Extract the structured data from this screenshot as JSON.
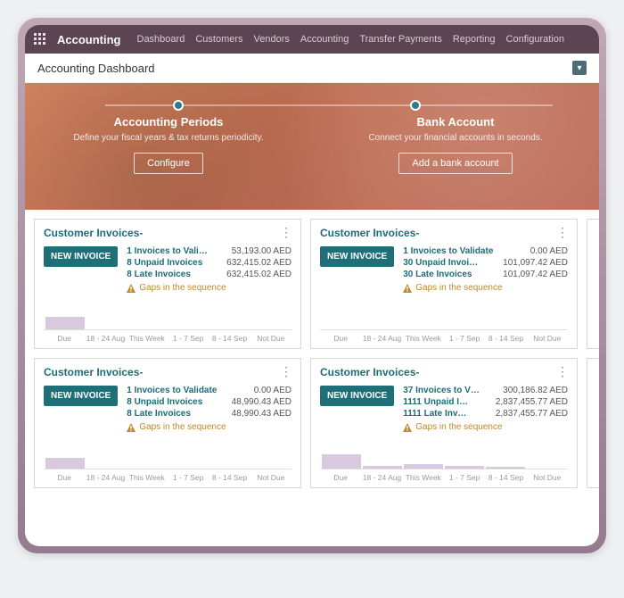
{
  "nav": {
    "brand": "Accounting",
    "items": [
      "Dashboard",
      "Customers",
      "Vendors",
      "Accounting",
      "Transfer Payments",
      "Reporting",
      "Configuration"
    ]
  },
  "page_title": "Accounting Dashboard",
  "hero": {
    "steps": [
      {
        "title": "Accounting Periods",
        "desc": "Define your fiscal years & tax returns periodicity.",
        "button": "Configure"
      },
      {
        "title": "Bank Account",
        "desc": "Connect your financial accounts in seconds.",
        "button": "Add a bank account"
      }
    ]
  },
  "axis_labels": [
    "Due",
    "18 - 24 Aug",
    "This Week",
    "1 - 7 Sep",
    "8 - 14 Sep",
    "Not Due"
  ],
  "cards": [
    {
      "title": "Customer Invoices-",
      "button": "NEW INVOICE",
      "stats": [
        {
          "label": "1 Invoices to Vali…",
          "value": "53,193.00 AED"
        },
        {
          "label": "8 Unpaid Invoices",
          "value": "632,415.02 AED"
        },
        {
          "label": "8 Late Invoices",
          "value": "632,415.02 AED"
        }
      ],
      "warning": "Gaps in the sequence",
      "bars": [
        14,
        0,
        0,
        0,
        0,
        0
      ]
    },
    {
      "title": "Customer Invoices-",
      "button": "NEW INVOICE",
      "stats": [
        {
          "label": "1 Invoices to Validate",
          "value": "0.00 AED"
        },
        {
          "label": "30 Unpaid Invoi…",
          "value": "101,097.42 AED"
        },
        {
          "label": "30 Late Invoices",
          "value": "101,097.42 AED"
        }
      ],
      "warning": "Gaps in the sequence",
      "bars": [
        0,
        0,
        0,
        0,
        0,
        0
      ]
    },
    {
      "title": "Customer Invoices-",
      "button": "NEW INVOICE",
      "stats": [
        {
          "label": "1 Invoices to Validate",
          "value": "0.00 AED"
        },
        {
          "label": "8 Unpaid Invoices",
          "value": "48,990.43 AED"
        },
        {
          "label": "8 Late Invoices",
          "value": "48,990.43 AED"
        }
      ],
      "warning": "Gaps in the sequence",
      "bars": [
        12,
        0,
        0,
        0,
        0,
        0
      ]
    },
    {
      "title": "Customer Invoices-",
      "button": "NEW INVOICE",
      "stats": [
        {
          "label": "37 Invoices to V…",
          "value": "300,186.82 AED"
        },
        {
          "label": "1111 Unpaid I…",
          "value": "2,837,455.77 AED"
        },
        {
          "label": "1111 Late Inv…",
          "value": "2,837,455.77 AED"
        }
      ],
      "warning": "Gaps in the sequence",
      "bars": [
        16,
        3,
        5,
        3,
        2,
        0
      ]
    }
  ],
  "chart_data": [
    {
      "type": "bar",
      "title": "Customer Invoices",
      "categories": [
        "Due",
        "18 - 24 Aug",
        "This Week",
        "1 - 7 Sep",
        "8 - 14 Sep",
        "Not Due"
      ],
      "values": [
        14,
        0,
        0,
        0,
        0,
        0
      ],
      "ylim": [
        0,
        20
      ]
    },
    {
      "type": "bar",
      "title": "Customer Invoices",
      "categories": [
        "Due",
        "18 - 24 Aug",
        "This Week",
        "1 - 7 Sep",
        "8 - 14 Sep",
        "Not Due"
      ],
      "values": [
        0,
        0,
        0,
        0,
        0,
        0
      ],
      "ylim": [
        0,
        20
      ]
    },
    {
      "type": "bar",
      "title": "Customer Invoices",
      "categories": [
        "Due",
        "18 - 24 Aug",
        "This Week",
        "1 - 7 Sep",
        "8 - 14 Sep",
        "Not Due"
      ],
      "values": [
        12,
        0,
        0,
        0,
        0,
        0
      ],
      "ylim": [
        0,
        20
      ]
    },
    {
      "type": "bar",
      "title": "Customer Invoices",
      "categories": [
        "Due",
        "18 - 24 Aug",
        "This Week",
        "1 - 7 Sep",
        "8 - 14 Sep",
        "Not Due"
      ],
      "values": [
        16,
        3,
        5,
        3,
        2,
        0
      ],
      "ylim": [
        0,
        20
      ]
    }
  ]
}
